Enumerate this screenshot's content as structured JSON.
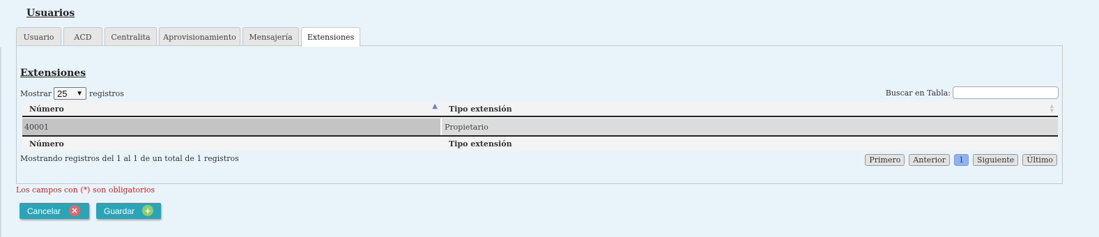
{
  "page": {
    "title": "Usuarios"
  },
  "tabs": [
    {
      "label": "Usuario"
    },
    {
      "label": "ACD"
    },
    {
      "label": "Centralita"
    },
    {
      "label": "Aprovisionamiento"
    },
    {
      "label": "Mensajería"
    },
    {
      "label": "Extensiones",
      "active": true
    }
  ],
  "section": {
    "title": "Extensiones"
  },
  "length_menu": {
    "prefix": "Mostrar",
    "value": "25",
    "suffix": "registros"
  },
  "search": {
    "label": "Buscar en Tabla:",
    "value": ""
  },
  "table": {
    "columns": [
      "Número",
      "Tipo extensión"
    ],
    "rows": [
      [
        "40001",
        "Propietario"
      ]
    ]
  },
  "info": "Mostrando registros del 1 al 1 de un total de 1 registros",
  "pagination": {
    "first": "Primero",
    "prev": "Anterior",
    "current": "1",
    "next": "Siguiente",
    "last": "Último"
  },
  "required_note": "Los campos con (*) son obligatorios",
  "buttons": {
    "cancel": {
      "label": "Cancelar",
      "icon": "cancel-x-icon"
    },
    "save": {
      "label": "Guardar",
      "icon": "add-plus-icon"
    }
  },
  "colors": {
    "accent": "#2aa5b8",
    "background": "#e9f4fa",
    "required": "#d62020",
    "page_active": "#8fb2f3"
  }
}
